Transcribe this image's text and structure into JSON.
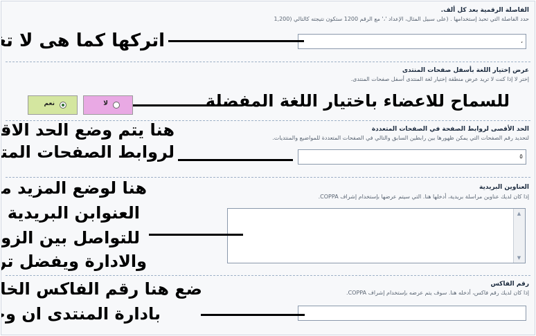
{
  "sections": [
    {
      "title": "الفاصلة الرقمية بعد كل ألف.",
      "description": "حدد الفاصلة التي تحبذ إستخدامها . (على سبيل المثال، الإعداد '،' مع الرقم 1200 ستكون نتيجته كالتالي (1,200",
      "value": "،"
    },
    {
      "title": "عرض إختيار اللغة بأسفل صفحات المنتدى",
      "description_line1": "إختر لا إذا كنت لا تريد عرض منطقة إختيار لغة المنتدى أسفل صفحات المنتدى.",
      "option_yes": "نعم",
      "option_no": "لا",
      "selected": "yes"
    },
    {
      "title": "الحد الأقصى لروابط الصفحة في الصفحات المتعددة",
      "description": "لتحديد رقم الصفحات التي يمكن ظهورها بين رابطين السابق والتالي في الصفحات المتعددة للمواضيع والمنتديات.",
      "value": "٥"
    },
    {
      "title": "العناوين البريدية",
      "description": "إذا كان لديك عناوين مراسلة بريدية، أدخلها هنا. التي سيتم عرضها بإستخدام إشراف COPPA."
    },
    {
      "title": "رقم الفاكس",
      "description": "إذا كان لديك رقم فاكس، أدخله هنا. سوف يتم عرضه بإستخدام إشراف COPPA.",
      "value": ""
    }
  ],
  "annotations": {
    "a1": "اتركها كما هى لا تغيرها",
    "a2": "للسماح للاعضاء باختيار اللغة المفضلة",
    "a3_l1": "هنا يتم وضع الحد الاقصى",
    "a3_l2": "لروابط الصفحات المتعددة",
    "a4_l1": "هنا لوضع المزيد من",
    "a4_l2": "العنوابن البريدية",
    "a4_l3": "للتواصل بين الزوار",
    "a4_l4": "والادارة ويفضل تركها",
    "a5_l1": "ضع هنا رقم الفاكس الخاص",
    "a5_l2": "بادارة المنتدى ان وجد."
  }
}
